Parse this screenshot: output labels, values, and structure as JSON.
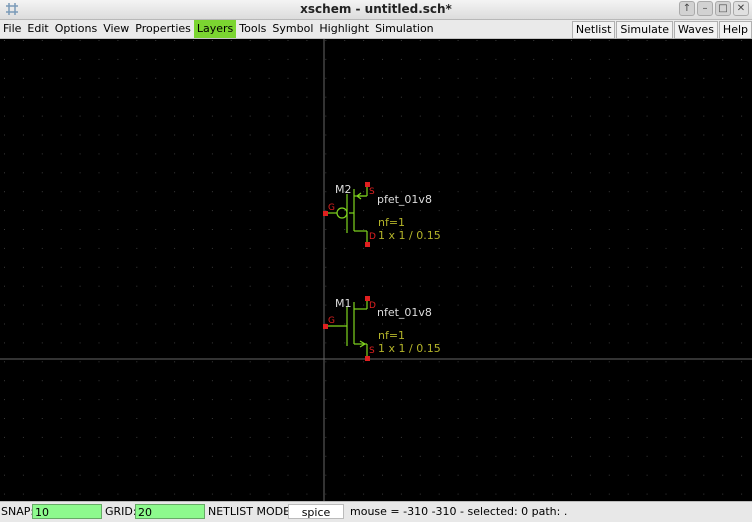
{
  "window": {
    "title": "xschem - untitled.sch*",
    "app_icon": "xschem-app-icon",
    "buttons": [
      "up-arrow-icon",
      "minimize-icon",
      "maximize-icon",
      "close-icon"
    ]
  },
  "menubar": {
    "left": [
      "File",
      "Edit",
      "Options",
      "View",
      "Properties",
      "Layers",
      "Tools",
      "Symbol",
      "Highlight",
      "Simulation"
    ],
    "highlighted": "Layers",
    "right": [
      "Netlist",
      "Simulate",
      "Waves",
      "Help"
    ]
  },
  "schematic": {
    "instances": [
      {
        "name": "M2",
        "symbol": "pfet_01v8",
        "nf": "nf=1",
        "size": "1 x 1 / 0.15",
        "pins": {
          "source": "S",
          "gate": "G",
          "drain": "D"
        }
      },
      {
        "name": "M1",
        "symbol": "nfet_01v8",
        "nf": "nf=1",
        "size": "1 x 1 / 0.15",
        "pins": {
          "drain": "D",
          "gate": "G",
          "source": "S"
        }
      }
    ]
  },
  "colors": {
    "background": "#000000",
    "grid_dot": "#3a3a3a",
    "axis": "#666666",
    "symbol_line": "#7fd41e",
    "pin": "#e02020",
    "label": "#dddddd",
    "param": "#b5b52a",
    "status_field": "#8dfa8d",
    "menu_highlight": "#7bd531"
  },
  "statusbar": {
    "snap_label": "SNAP:",
    "snap_value": "10",
    "grid_label": "GRID:",
    "grid_value": "20",
    "netlist_mode_label": "NETLIST MODE:",
    "netlist_mode_value": "spice",
    "info": "mouse = -310 -310 - selected: 0 path: ."
  }
}
